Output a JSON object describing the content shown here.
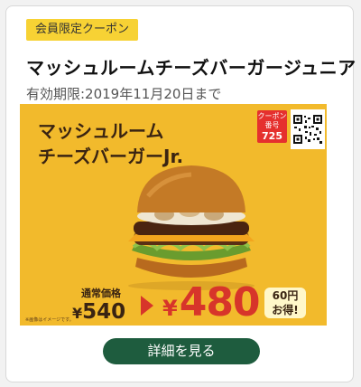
{
  "badge": "会員限定クーポン",
  "title": "マッシュルームチーズバーガージュニア",
  "expiry": "有効期限:2019年11月20日まで",
  "coupon": {
    "product_line1": "マッシュルーム",
    "product_line2": "チーズバーガーJr.",
    "coupon_number_label_line1": "クーポン",
    "coupon_number_label_line2": "番号",
    "coupon_number": "725",
    "regular_label": "通常価格",
    "regular_currency": "¥",
    "regular_price": "540",
    "sale_currency": "¥",
    "sale_price": "480",
    "savings_line1": "60円",
    "savings_line2": "お得!",
    "note": "※画像はイメージです。",
    "colors": {
      "background": "#f2ba2c",
      "accent": "#d7352a"
    }
  },
  "details_button": "詳細を見る",
  "colors": {
    "badge": "#f7d234",
    "button": "#1e5c3e"
  }
}
